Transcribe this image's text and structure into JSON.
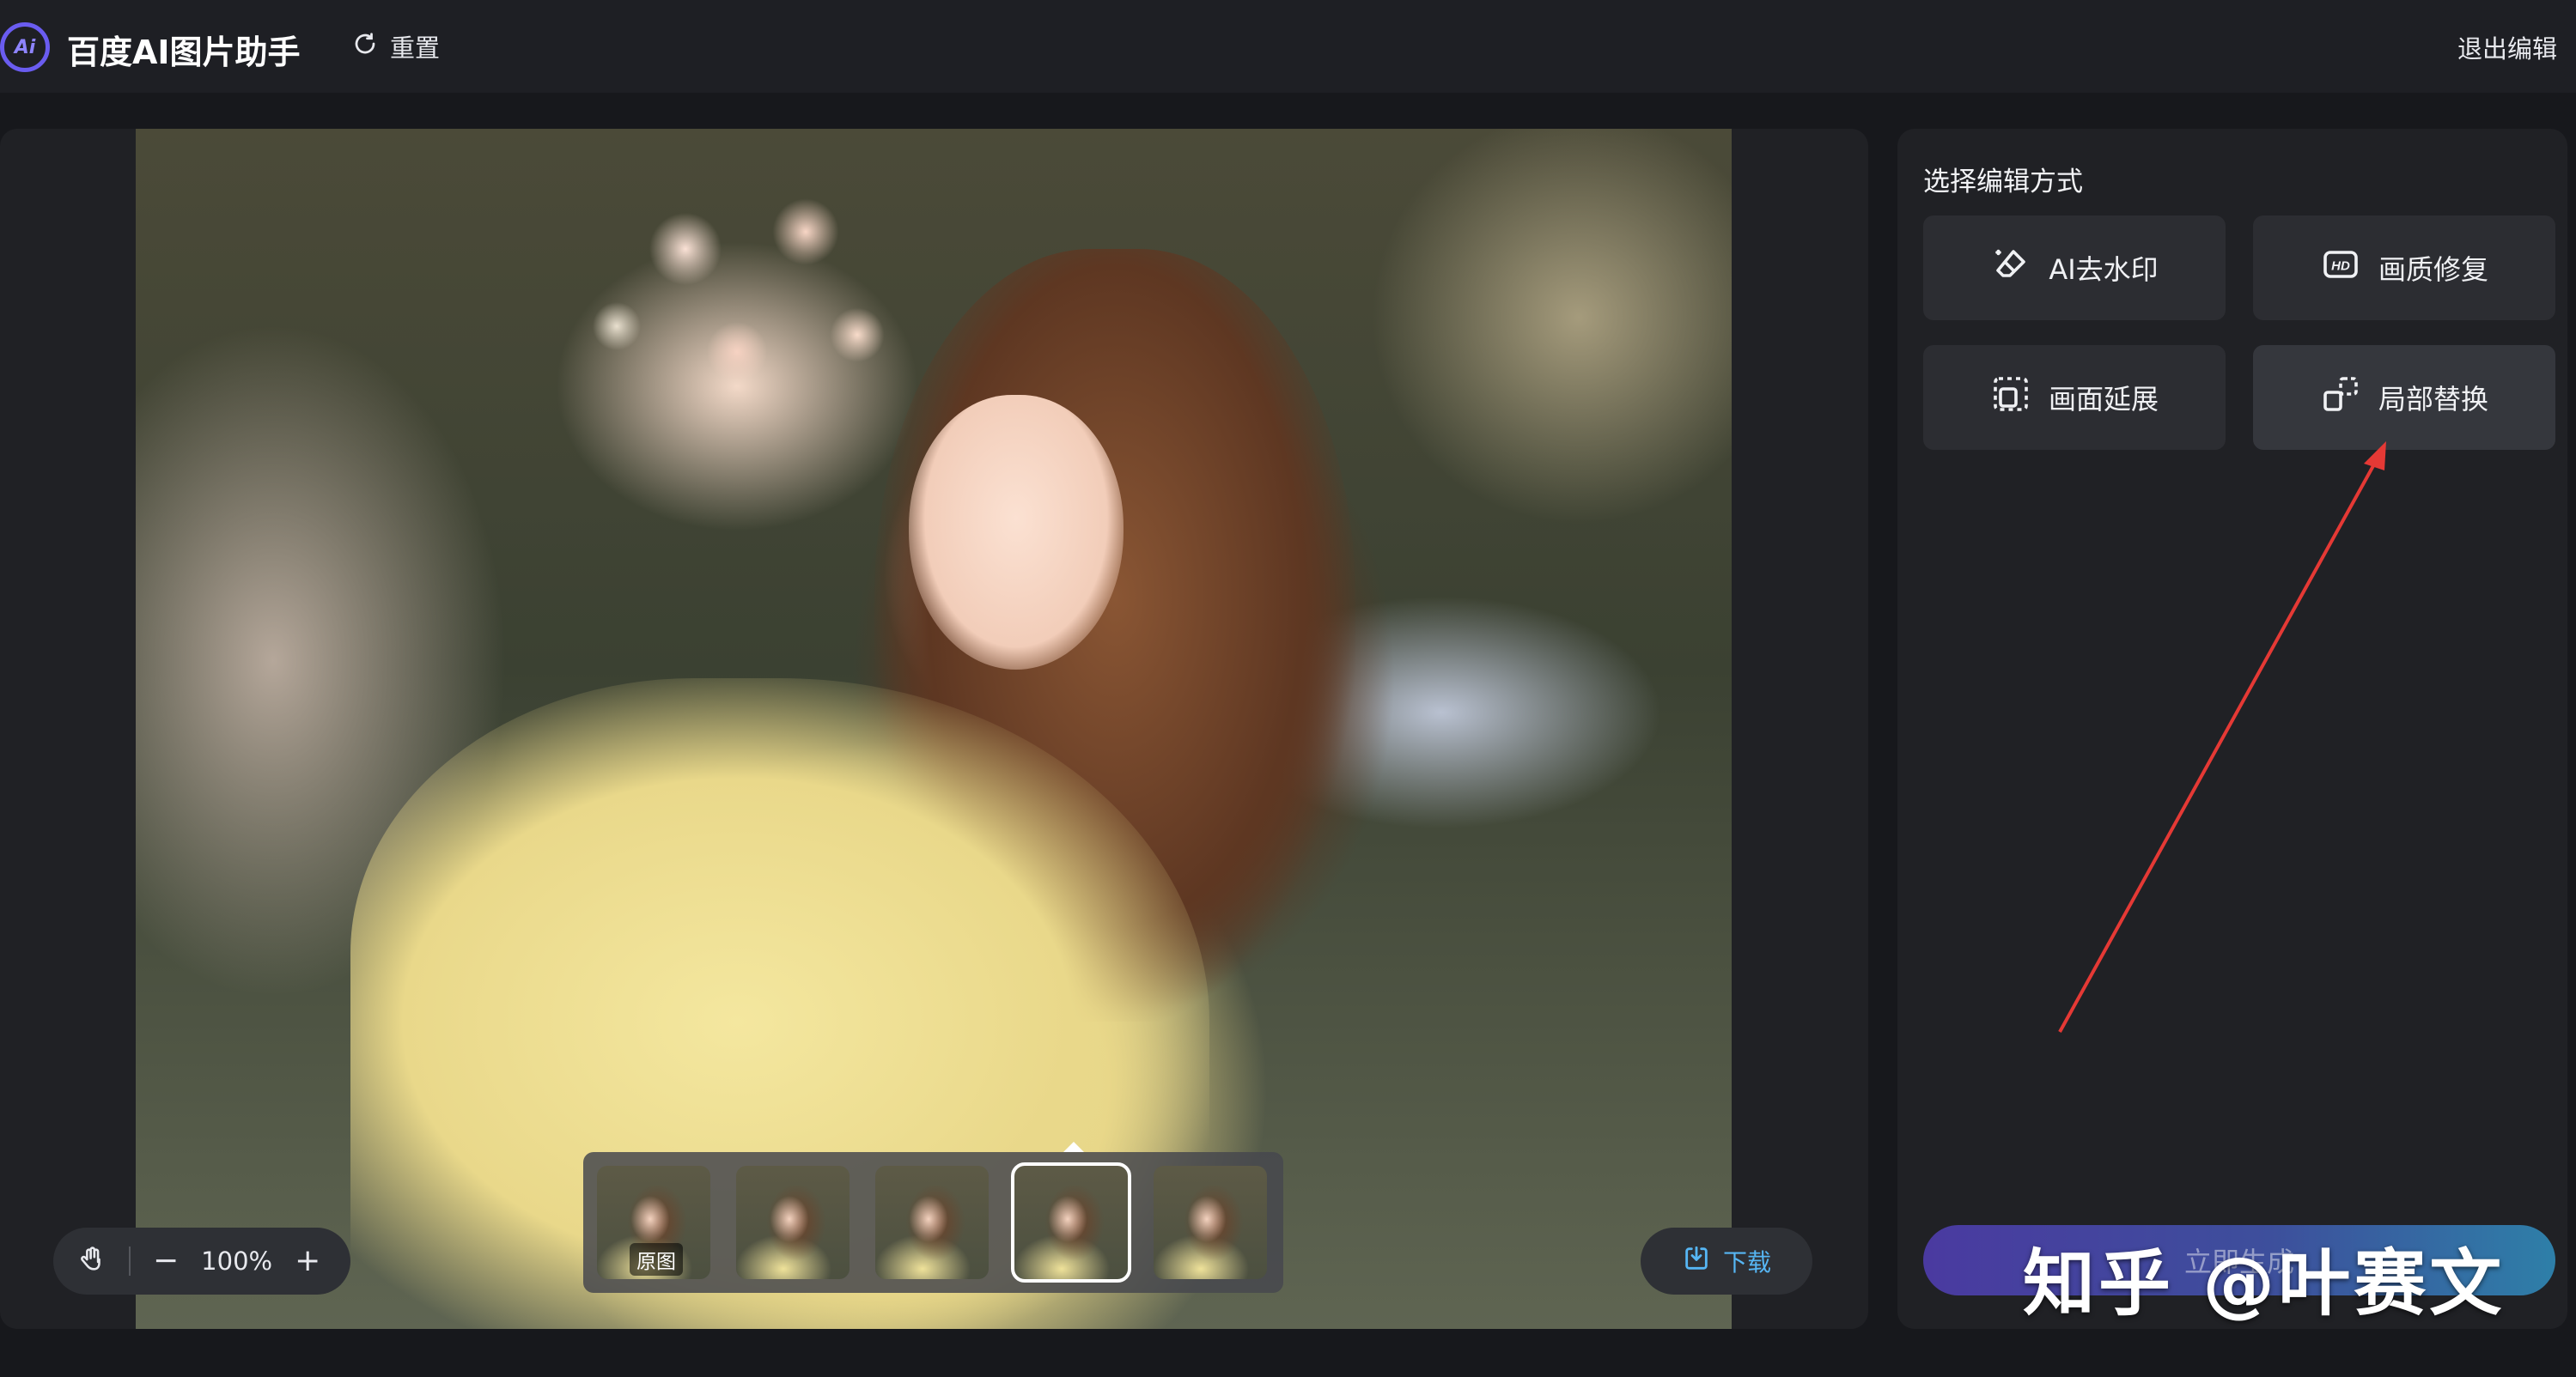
{
  "header": {
    "logo_text": "Ai",
    "app_title": "百度AI图片助手",
    "reset_label": "重置",
    "exit_label": "退出编辑"
  },
  "canvas": {
    "zoom_level": "100%",
    "zoom_out_symbol": "−",
    "zoom_in_symbol": "+",
    "thumbnails": [
      {
        "label": "原图",
        "active": false
      },
      {
        "label": "",
        "active": false
      },
      {
        "label": "",
        "active": false
      },
      {
        "label": "",
        "active": true
      },
      {
        "label": "",
        "active": false
      }
    ],
    "download_label": "下载"
  },
  "panel": {
    "heading": "选择编辑方式",
    "modes": [
      {
        "label": "AI去水印",
        "icon": "eraser-icon"
      },
      {
        "label": "画质修复",
        "icon": "hd-icon"
      },
      {
        "label": "画面延展",
        "icon": "expand-icon"
      },
      {
        "label": "局部替换",
        "icon": "replace-icon"
      }
    ],
    "start_label": "立即生成"
  },
  "overlay": {
    "watermark": "知乎 @叶赛文",
    "arrow_color": "#e53935"
  }
}
